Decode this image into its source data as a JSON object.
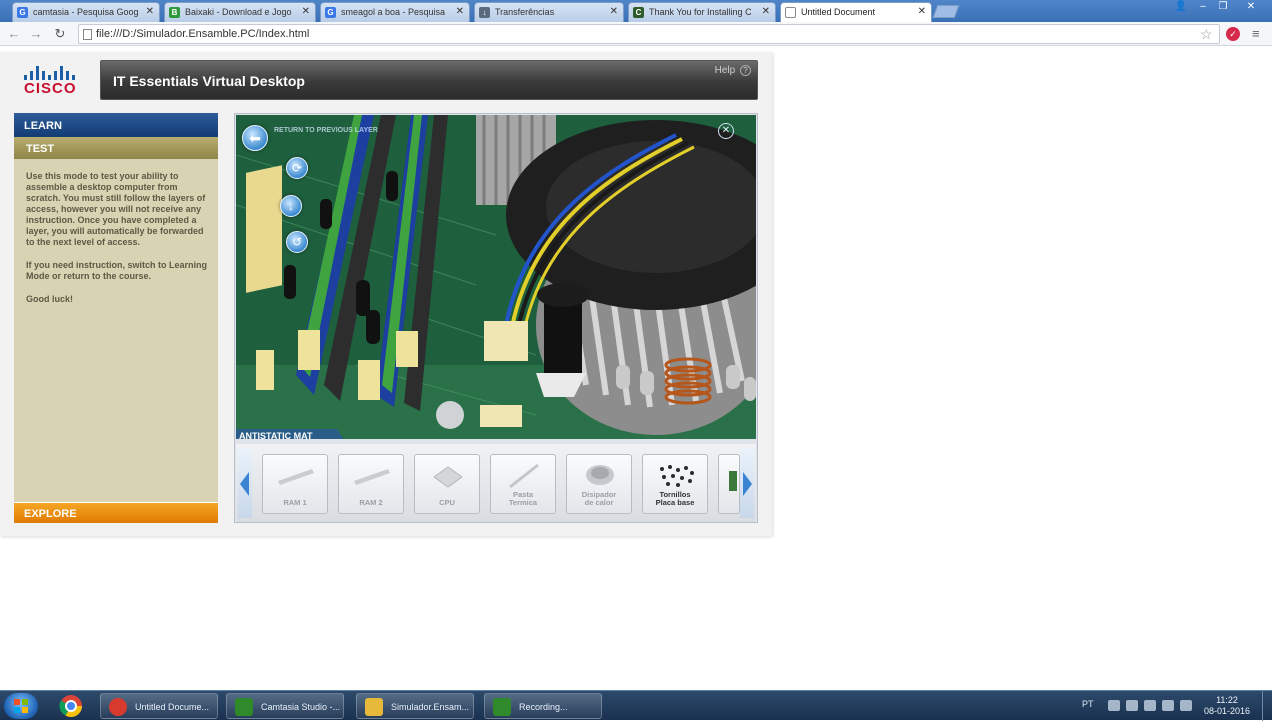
{
  "browser": {
    "tabs": [
      {
        "label": "camtasia - Pesquisa Goog",
        "icon": "google-icon",
        "color": "#3b78e7"
      },
      {
        "label": "Baixaki - Download e Jogo",
        "icon": "baixaki-icon",
        "color": "#2c9a3c"
      },
      {
        "label": "smeagol a boa - Pesquisa",
        "icon": "google-icon",
        "color": "#3b78e7"
      },
      {
        "label": "Transferências",
        "icon": "download-icon",
        "color": "#5a6b80"
      },
      {
        "label": "Thank You for Installing C",
        "icon": "camtasia-icon",
        "color": "#2d5e2a"
      },
      {
        "label": "Untitled Document",
        "icon": "page-icon",
        "color": "#8a8a8a"
      }
    ],
    "url": "file:///D:/Simulador.Ensamble.PC/Index.html"
  },
  "app": {
    "logo_text": "CISCO",
    "title": "IT Essentials Virtual Desktop",
    "help_label": "Help",
    "help_glyph": "?",
    "sidebar": {
      "learn": "LEARN",
      "test": "TEST",
      "paragraphs": [
        "Use this mode to test your ability to assemble a desktop computer from scratch. You must still follow the layers of access, however you will not receive any instruction. Once you have completed a layer, you will automatically be forwarded to the next level of access.",
        "If you need instruction, switch to Learning Mode or return to the course.",
        "Good luck!"
      ],
      "explore": "EXPLORE"
    },
    "viewer": {
      "return_text": "RETURN TO PREVIOUS LAYER",
      "mat_label": "ANTISTATIC MAT",
      "parts": [
        {
          "line1": "RAM 1",
          "line2": "",
          "active": false
        },
        {
          "line1": "RAM 2",
          "line2": "",
          "active": false
        },
        {
          "line1": "CPU",
          "line2": "",
          "active": false
        },
        {
          "line1": "Pasta",
          "line2": "Termica",
          "active": false
        },
        {
          "line1": "Disipador",
          "line2": "de calor",
          "active": false
        },
        {
          "line1": "Tornillos",
          "line2": "Placa base",
          "active": true
        }
      ]
    }
  },
  "taskbar": {
    "items": [
      {
        "label": "Untitled Docume...",
        "color": "#d83b2e"
      },
      {
        "label": "Camtasia Studio -...",
        "color": "#2f8a2b"
      },
      {
        "label": "Simulador.Ensam...",
        "color": "#e6b93a"
      },
      {
        "label": "Recording...",
        "color": "#2f8a2b"
      }
    ],
    "language": "PT",
    "time": "11:22",
    "date": "08-01-2016"
  }
}
